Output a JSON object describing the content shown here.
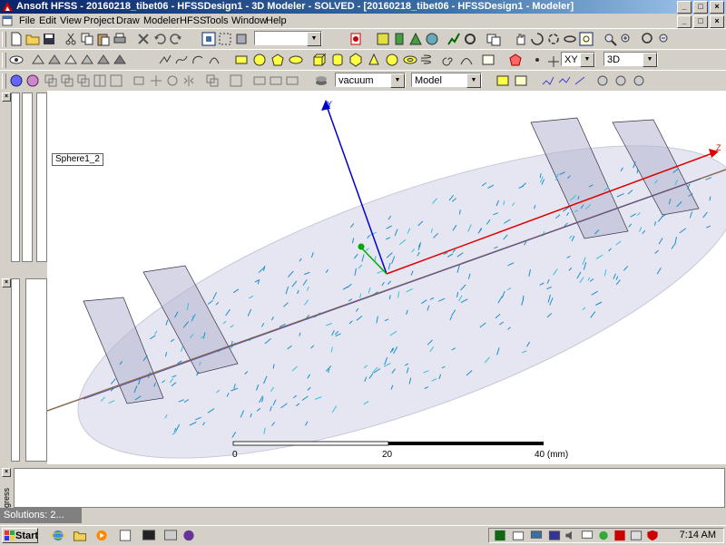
{
  "window": {
    "title": "Ansoft HFSS - 20160218_tibet06 - HFSSDesign1 - 3D Modeler - SOLVED - [20160218_tibet06 - HFSSDesign1 - Modeler]",
    "buttons": [
      "minimize",
      "maximize",
      "close"
    ]
  },
  "menu": [
    "File",
    "Edit",
    "View",
    "Project",
    "Draw",
    "Modeler",
    "HFSS",
    "Tools",
    "Window",
    "Help"
  ],
  "toolbar": {
    "combo_blank": "",
    "plane_select": "XY",
    "mode_select": "3D",
    "material_select": "vacuum",
    "model_select": "Model"
  },
  "viewport": {
    "object_label": "Sphere1_2",
    "axes": {
      "x": "",
      "y": "Y",
      "z": "Z"
    },
    "ruler": {
      "ticks": [
        "0",
        "20",
        "40 (mm)"
      ]
    },
    "colors": {
      "ellipsoid": "#e6e6f2",
      "band": "#b4b4d2",
      "y_axis": "#0000cc",
      "z_axis": "#dd0000",
      "x_axis": "#00aa00",
      "field": "#1a8fc8"
    }
  },
  "bottom": {
    "message_tab": "gress",
    "solutions_title": "Solutions: 2..."
  },
  "taskbar": {
    "start_label": "Start",
    "clock": "7:14 AM"
  }
}
